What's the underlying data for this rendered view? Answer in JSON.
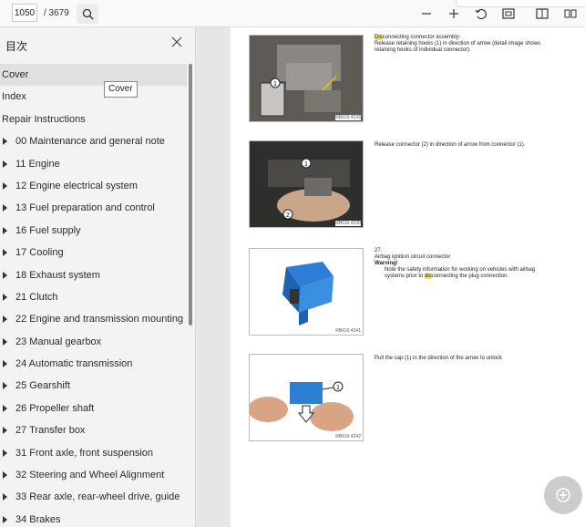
{
  "toolbar": {
    "page_current": "1050",
    "page_total": "/ 3679",
    "icons": [
      "search-icon",
      "minus-icon",
      "plus-icon",
      "rotate-icon",
      "fit-page-icon",
      "two-page-icon",
      "more-icon"
    ]
  },
  "sidebar": {
    "title": "目次",
    "tooltip": "Cover",
    "items": [
      {
        "label": "Cover",
        "expandable": false
      },
      {
        "label": "Index",
        "expandable": false
      },
      {
        "label": "Repair Instructions",
        "expandable": false
      },
      {
        "label": "00 Maintenance and general note",
        "expandable": true
      },
      {
        "label": "11 Engine",
        "expandable": true
      },
      {
        "label": "12 Engine electrical system",
        "expandable": true
      },
      {
        "label": "13 Fuel preparation and control",
        "expandable": true
      },
      {
        "label": "16 Fuel supply",
        "expandable": true
      },
      {
        "label": "17 Cooling",
        "expandable": true
      },
      {
        "label": "18 Exhaust system",
        "expandable": true
      },
      {
        "label": "21 Clutch",
        "expandable": true
      },
      {
        "label": "22 Engine and transmission mounting",
        "expandable": true
      },
      {
        "label": "23 Manual gearbox",
        "expandable": true
      },
      {
        "label": "24 Automatic transmission",
        "expandable": true
      },
      {
        "label": "25 Gearshift",
        "expandable": true
      },
      {
        "label": "26 Propeller shaft",
        "expandable": true
      },
      {
        "label": "27 Transfer box",
        "expandable": true
      },
      {
        "label": "31 Front axle, front suspension",
        "expandable": true
      },
      {
        "label": "32 Steering and Wheel Alignment",
        "expandable": true
      },
      {
        "label": "33 Rear axle, rear-wheel drive, guide",
        "expandable": true
      },
      {
        "label": "34 Brakes",
        "expandable": true
      }
    ]
  },
  "document": {
    "steps": [
      {
        "fig_code": "RB616 4236",
        "lines": [
          "Disconnecting connector assembly:",
          "Release retaining hooks (1) in direction of arrow (detail image shows",
          "retaining hooks of individual connector)."
        ],
        "highlight": "Dis"
      },
      {
        "fig_code": "RB616 4230",
        "lines": [
          "Release connector (2) in direction of arrow from connector (1)."
        ],
        "highlight": ""
      },
      {
        "fig_code": "RB616 4241",
        "lines": [
          "27.",
          "Airbag ignition circuit connector"
        ],
        "warning": "Warning!",
        "note_pre": "Note the safety information for working on vehicles with airbag",
        "note_post_a": "systems prior to ",
        "note_hl": "dis",
        "note_post_b": "connecting the plug connection.",
        "highlight": ""
      },
      {
        "fig_code": "RB616 4242",
        "lines": [
          "Pull the cap (1) in the direction of the arrow to unlock"
        ],
        "highlight": ""
      }
    ]
  }
}
